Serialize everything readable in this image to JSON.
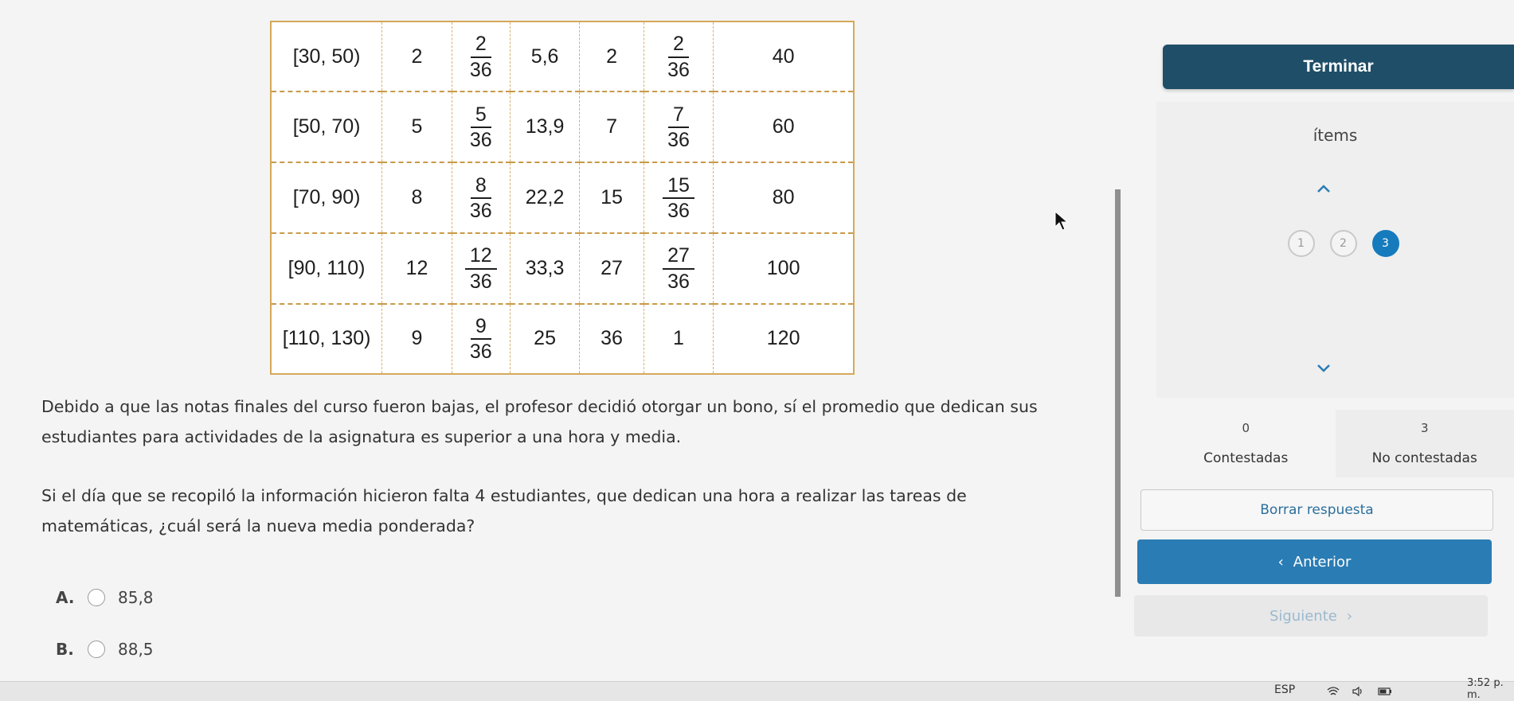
{
  "table": {
    "rows": [
      {
        "interval": "[30, 50)",
        "freq": "2",
        "rel_num": "2",
        "rel_den": "36",
        "percent": "5,6",
        "cum": "2",
        "cum_num": "2",
        "cum_den": "36",
        "mark": "40"
      },
      {
        "interval": "[50, 70)",
        "freq": "5",
        "rel_num": "5",
        "rel_den": "36",
        "percent": "13,9",
        "cum": "7",
        "cum_num": "7",
        "cum_den": "36",
        "mark": "60"
      },
      {
        "interval": "[70, 90)",
        "freq": "8",
        "rel_num": "8",
        "rel_den": "36",
        "percent": "22,2",
        "cum": "15",
        "cum_num": "15",
        "cum_den": "36",
        "mark": "80"
      },
      {
        "interval": "[90, 110)",
        "freq": "12",
        "rel_num": "12",
        "rel_den": "36",
        "percent": "33,3",
        "cum": "27",
        "cum_num": "27",
        "cum_den": "36",
        "mark": "100"
      },
      {
        "interval": "[110, 130)",
        "freq": "9",
        "rel_num": "9",
        "rel_den": "36",
        "percent": "25",
        "cum": "36",
        "cum_text": "1",
        "mark": "120"
      }
    ]
  },
  "question": {
    "paragraph1": "Debido a que las notas finales del curso fueron bajas, el profesor decidió otorgar un bono, sí el promedio que dedican sus estudiantes para actividades de la asignatura es superior a una hora y media.",
    "paragraph2": "Si el día que se recopiló la información hicieron falta 4 estudiantes, que dedican una hora a realizar las tareas de matemáticas, ¿cuál será la nueva media ponderada?",
    "options": [
      {
        "letter": "A.",
        "value": "85,8"
      },
      {
        "letter": "B.",
        "value": "88,5"
      }
    ]
  },
  "sidebar": {
    "finish_label": "Terminar",
    "items_title": "ítems",
    "items": [
      "1",
      "2",
      "3"
    ],
    "current_item": "3",
    "answered_count": "0",
    "answered_label": "Contestadas",
    "unanswered_count": "3",
    "unanswered_label": "No contestadas",
    "clear_label": "Borrar respuesta",
    "prev_label": "Anterior",
    "next_label": "Siguiente"
  },
  "taskbar": {
    "language": "ESP",
    "time": "3:52 p. m."
  },
  "colors": {
    "primary_dark": "#1f4f68",
    "primary": "#2a7cb4",
    "active_item": "#167bbd",
    "table_border": "#d4a85a"
  }
}
